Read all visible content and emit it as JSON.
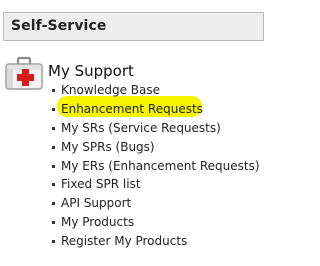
{
  "header": {
    "title": "Self-Service"
  },
  "section": {
    "title": "My Support",
    "icon": "first-aid-kit-icon"
  },
  "links": [
    {
      "label": "Knowledge Base"
    },
    {
      "label": "Enhancement Requests",
      "highlighted": true
    },
    {
      "label": "My SRs (Service Requests)"
    },
    {
      "label": "My SPRs (Bugs)"
    },
    {
      "label": "My ERs (Enhancement Requests)"
    },
    {
      "label": "Fixed SPR list"
    },
    {
      "label": "API Support"
    },
    {
      "label": "My Products"
    },
    {
      "label": "Register My Products"
    }
  ],
  "colors": {
    "header_bg": "#eeeeee",
    "header_border": "#b9b9b9",
    "highlight": "#f5f500",
    "kit_red": "#d81c1c"
  }
}
